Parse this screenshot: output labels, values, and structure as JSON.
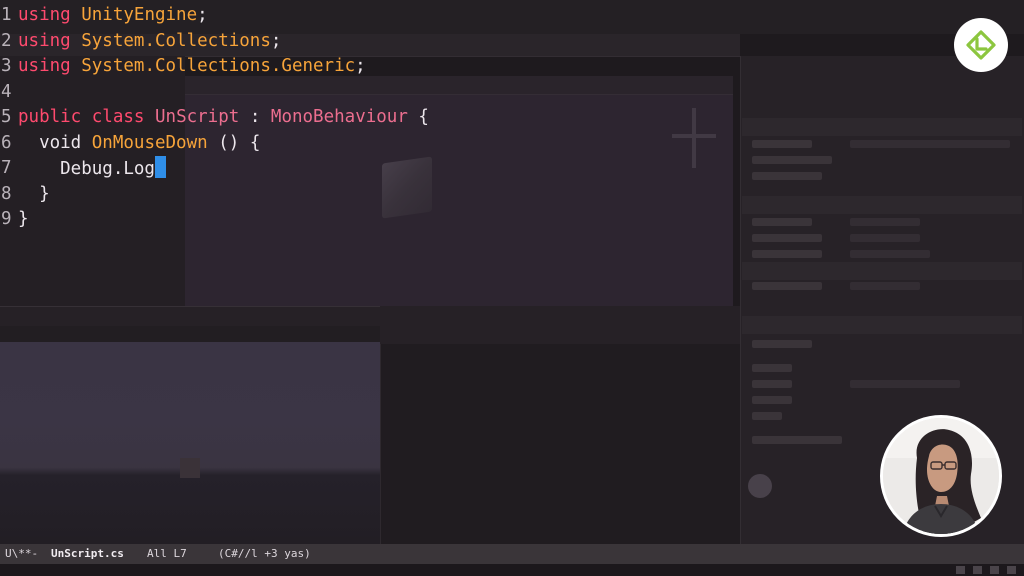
{
  "editor": {
    "lines": [
      {
        "num": "1",
        "tokens": [
          {
            "t": "using",
            "c": "kw"
          },
          {
            "t": " ",
            "c": "pl"
          },
          {
            "t": "UnityEngine",
            "c": "ty"
          },
          {
            "t": ";",
            "c": "pl"
          }
        ]
      },
      {
        "num": "2",
        "tokens": [
          {
            "t": "using",
            "c": "kw"
          },
          {
            "t": " ",
            "c": "pl"
          },
          {
            "t": "System.Collections",
            "c": "ty"
          },
          {
            "t": ";",
            "c": "pl"
          }
        ]
      },
      {
        "num": "3",
        "tokens": [
          {
            "t": "using",
            "c": "kw"
          },
          {
            "t": " ",
            "c": "pl"
          },
          {
            "t": "System.Collections.Generic",
            "c": "ty"
          },
          {
            "t": ";",
            "c": "pl"
          }
        ]
      },
      {
        "num": "4",
        "tokens": []
      },
      {
        "num": "5",
        "tokens": [
          {
            "t": "public",
            "c": "kw"
          },
          {
            "t": " ",
            "c": "pl"
          },
          {
            "t": "class",
            "c": "kw"
          },
          {
            "t": " ",
            "c": "pl"
          },
          {
            "t": "UnScript",
            "c": "fn"
          },
          {
            "t": " : ",
            "c": "pl"
          },
          {
            "t": "MonoBehaviour",
            "c": "fn"
          },
          {
            "t": " {",
            "c": "pl"
          }
        ]
      },
      {
        "num": "6",
        "tokens": [
          {
            "t": "  void ",
            "c": "pl"
          },
          {
            "t": "OnMouseDown",
            "c": "ty"
          },
          {
            "t": " () {",
            "c": "pl"
          }
        ]
      },
      {
        "num": "7",
        "tokens": [
          {
            "t": "    Debug.Log",
            "c": "pl"
          }
        ],
        "cursor": true
      },
      {
        "num": "8",
        "tokens": [
          {
            "t": "  }",
            "c": "pl"
          }
        ]
      },
      {
        "num": "9",
        "tokens": [
          {
            "t": "}",
            "c": "pl"
          }
        ]
      }
    ]
  },
  "modeline": {
    "status": "U\\**-",
    "filename": "UnScript.cs",
    "position": "All L7",
    "mode": "(C#//l +3 yas)"
  },
  "icons": {
    "logo": "lynda-logo-icon",
    "presenter": "presenter-webcam"
  },
  "colors": {
    "keyword": "#ff4a6e",
    "type": "#f7a43a",
    "identifier": "#ec6e8f",
    "plain": "#ece6ec",
    "cursor": "#2f8ee8",
    "logo_green": "#8cc63f"
  }
}
